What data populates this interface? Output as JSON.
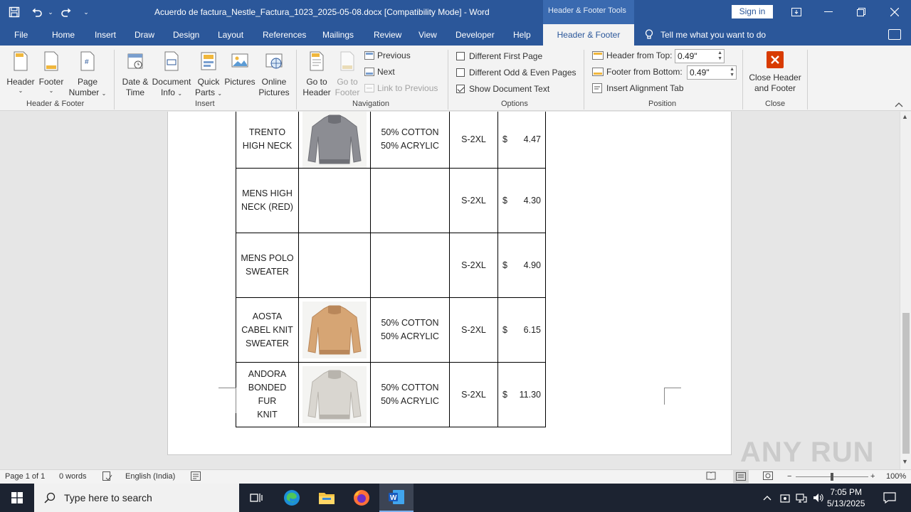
{
  "titlebar": {
    "document_title": "Acuerdo de factura_Nestle_Factura_1023_2025-05-08.docx [Compatibility Mode]  -  Word",
    "contextual_tools": "Header & Footer Tools",
    "signin_label": "Sign in",
    "undo_dropdown": "⌄",
    "customize_qat": "⌄"
  },
  "tabs": {
    "file": "File",
    "home": "Home",
    "insert": "Insert",
    "draw": "Draw",
    "design": "Design",
    "layout": "Layout",
    "references": "References",
    "mailings": "Mailings",
    "review": "Review",
    "view": "View",
    "developer": "Developer",
    "help": "Help",
    "header_footer": "Header & Footer",
    "tell_me": "Tell me what you want to do"
  },
  "ribbon": {
    "header_footer_group": {
      "label": "Header & Footer",
      "header": "Header",
      "footer": "Footer",
      "page_number_line1": "Page",
      "page_number_line2": "Number"
    },
    "insert_group": {
      "label": "Insert",
      "date_time_line1": "Date &",
      "date_time_line2": "Time",
      "document_info_line1": "Document",
      "document_info_line2": "Info",
      "quick_parts_line1": "Quick",
      "quick_parts_line2": "Parts",
      "pictures": "Pictures",
      "online_pictures_line1": "Online",
      "online_pictures_line2": "Pictures"
    },
    "navigation_group": {
      "label": "Navigation",
      "go_to_header_line1": "Go to",
      "go_to_header_line2": "Header",
      "go_to_footer_line1": "Go to",
      "go_to_footer_line2": "Footer",
      "previous": "Previous",
      "next": "Next",
      "link_to_previous": "Link to Previous"
    },
    "options_group": {
      "label": "Options",
      "different_first_page": "Different First Page",
      "different_odd_even": "Different Odd & Even Pages",
      "show_document_text": "Show Document Text",
      "different_first_page_checked": false,
      "different_odd_even_checked": false,
      "show_document_text_checked": true
    },
    "position_group": {
      "label": "Position",
      "header_from_top_label": "Header from Top:",
      "header_from_top_value": "0.49\"",
      "footer_from_bottom_label": "Footer from Bottom:",
      "footer_from_bottom_value": "0.49\"",
      "insert_alignment_tab": "Insert Alignment Tab"
    },
    "close_group": {
      "label": "Close",
      "close_line1": "Close Header",
      "close_line2": "and Footer"
    }
  },
  "table": {
    "rows": [
      {
        "name_lines": [
          "TRENTO",
          "HIGH NECK"
        ],
        "has_image": true,
        "image": "grey-sweater",
        "material_lines": [
          "50% COTTON",
          "50% ACRYLIC"
        ],
        "size": "S-2XL",
        "currency": "$",
        "price": "4.47"
      },
      {
        "name_lines": [
          "MENS HIGH",
          "NECK (RED)"
        ],
        "has_image": false,
        "image": "",
        "material_lines": [],
        "size": "S-2XL",
        "currency": "$",
        "price": "4.30"
      },
      {
        "name_lines": [
          "MENS POLO",
          "SWEATER"
        ],
        "has_image": false,
        "image": "",
        "material_lines": [],
        "size": "S-2XL",
        "currency": "$",
        "price": "4.90"
      },
      {
        "name_lines": [
          "AOSTA",
          "CABEL KNIT",
          "SWEATER"
        ],
        "has_image": true,
        "image": "tan-sweater",
        "material_lines": [
          "50% COTTON",
          "50% ACRYLIC"
        ],
        "size": "S-2XL",
        "currency": "$",
        "price": "6.15"
      },
      {
        "name_lines": [
          "ANDORA",
          "BONDED FUR",
          "KNIT"
        ],
        "has_image": true,
        "image": "light-grey-sweater",
        "material_lines": [
          "50% COTTON",
          "50% ACRYLIC"
        ],
        "size": "S-2XL",
        "currency": "$",
        "price": "11.30"
      }
    ]
  },
  "statusbar": {
    "page": "Page 1 of 1",
    "words": "0 words",
    "language": "English (India)",
    "zoom": "100%",
    "zoom_minus": "−",
    "zoom_plus": "+"
  },
  "taskbar": {
    "search_placeholder": "Type here to search",
    "time": "7:05 PM",
    "date": "5/13/2025"
  },
  "watermark": "ANY RUN",
  "colors": {
    "word_blue": "#2b579a",
    "close_red": "#d83b01",
    "taskbar": "#1c2331"
  }
}
